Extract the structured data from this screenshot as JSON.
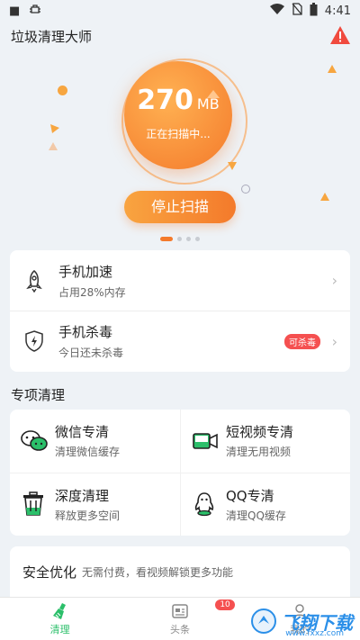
{
  "status_bar": {
    "time": "4:41"
  },
  "app": {
    "title": "垃圾清理大师"
  },
  "scan": {
    "size_value": "270",
    "size_unit": "MB",
    "status": "正在扫描中...",
    "stop_label": "停止扫描"
  },
  "quick_actions": [
    {
      "title": "手机加速",
      "subtitle": "占用28%内存"
    },
    {
      "title": "手机杀毒",
      "subtitle": "今日还未杀毒",
      "badge": "可杀毒"
    }
  ],
  "special": {
    "title": "专项清理",
    "items": [
      {
        "title": "微信专清",
        "subtitle": "清理微信缓存"
      },
      {
        "title": "短视频专清",
        "subtitle": "清理无用视频"
      },
      {
        "title": "深度清理",
        "subtitle": "释放更多空间"
      },
      {
        "title": "QQ专清",
        "subtitle": "清理QQ缓存"
      }
    ]
  },
  "security": {
    "title": "安全优化",
    "subtitle": "无需付费，看视频解锁更多功能"
  },
  "bottom_nav": [
    {
      "label": "清理",
      "active": true
    },
    {
      "label": "头条",
      "badge": "10"
    },
    {
      "label": "我的"
    }
  ],
  "watermark": {
    "text": "飞翔下载",
    "url": "www.fxxz.com"
  },
  "colors": {
    "accent": "#f47a2b",
    "green": "#2bbf6a",
    "badge_red": "#f55050"
  }
}
